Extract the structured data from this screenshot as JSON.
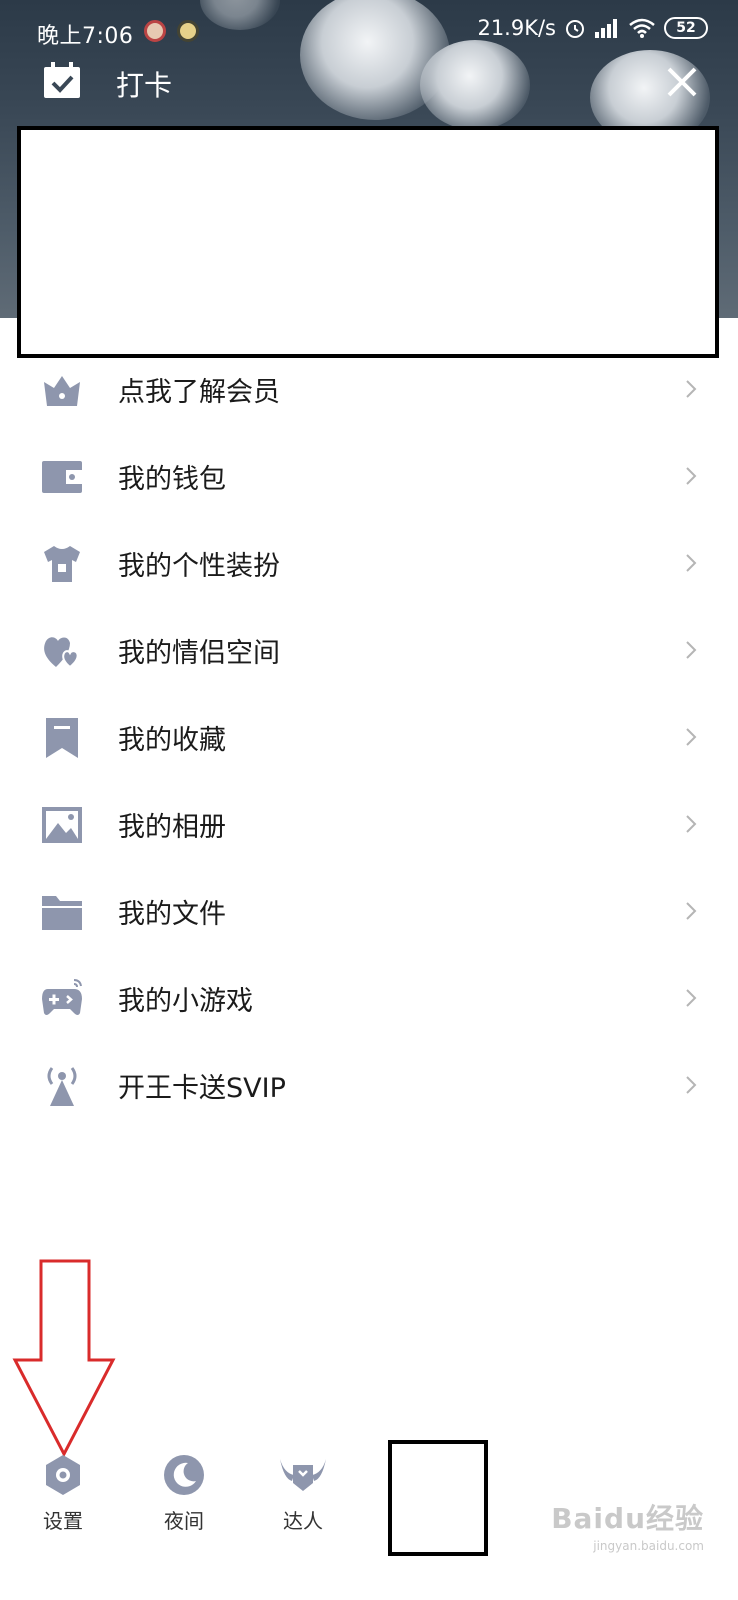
{
  "status_bar": {
    "time": "晚上7:06",
    "net_speed": "21.9K/s",
    "battery": "52"
  },
  "header": {
    "title": "打卡"
  },
  "menu": {
    "items": [
      {
        "label": "点我了解会员",
        "icon": "crown-icon"
      },
      {
        "label": "我的钱包",
        "icon": "wallet-icon"
      },
      {
        "label": "我的个性装扮",
        "icon": "shirt-icon"
      },
      {
        "label": "我的情侣空间",
        "icon": "hearts-icon"
      },
      {
        "label": "我的收藏",
        "icon": "bookmark-icon"
      },
      {
        "label": "我的相册",
        "icon": "photo-icon"
      },
      {
        "label": "我的文件",
        "icon": "folder-icon"
      },
      {
        "label": "我的小游戏",
        "icon": "gamepad-icon"
      },
      {
        "label": "开王卡送SVIP",
        "icon": "antenna-icon"
      }
    ]
  },
  "bottom": {
    "settings": "设置",
    "night": "夜间",
    "expert": "达人"
  },
  "watermark": {
    "main": "Baidu经验",
    "sub": "jingyan.baidu.com"
  },
  "colors": {
    "icon_gray": "#8e96ad",
    "annotation_red": "#d92b2b"
  }
}
